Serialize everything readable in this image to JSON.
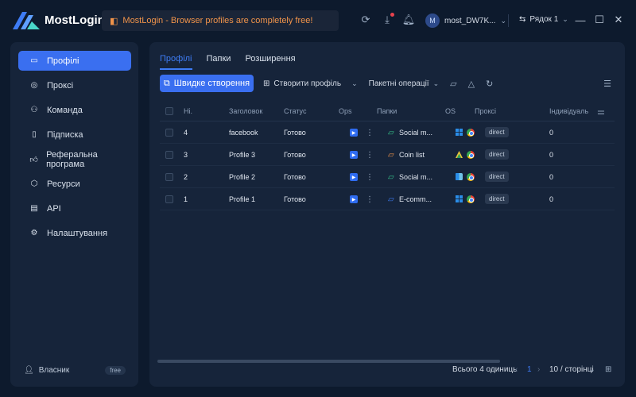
{
  "app": {
    "title": "MostLogin"
  },
  "banner": {
    "text": "MostLogin - Browser profiles are completely free!"
  },
  "header": {
    "user_initial": "M",
    "user_name": "most_DW7K...",
    "language": "Рядок 1"
  },
  "sidebar": {
    "items": [
      {
        "label": "Профілі",
        "icon": "profile-card-icon",
        "active": true
      },
      {
        "label": "Проксі",
        "icon": "location-pin-icon"
      },
      {
        "label": "Команда",
        "icon": "team-icon"
      },
      {
        "label": "Підписка",
        "icon": "subscription-icon"
      },
      {
        "label": "Реферальна програма",
        "icon": "thumbs-up-icon"
      },
      {
        "label": "Ресурси",
        "icon": "cube-icon"
      },
      {
        "label": "API",
        "icon": "api-icon"
      },
      {
        "label": "Налаштування",
        "icon": "gear-icon"
      }
    ],
    "owner_label": "Власник",
    "plan_badge": "free"
  },
  "tabs": [
    {
      "label": "Профілі",
      "active": true
    },
    {
      "label": "Папки"
    },
    {
      "label": "Розширення"
    }
  ],
  "toolbar": {
    "quick_create": "Швидке створення",
    "create_profile": "Створити профіль",
    "batch_ops": "Пакетні операції"
  },
  "table": {
    "columns": [
      "Ні.",
      "Заголовок",
      "Статус",
      "Ops",
      "Папки",
      "OS",
      "Проксі",
      "Індивідуаль"
    ],
    "rows": [
      {
        "no": "4",
        "title": "facebook",
        "status": "Готово",
        "folder": "Social m...",
        "folder_color": "#35c48a",
        "os": "windows",
        "proxy": "direct",
        "individual": "0"
      },
      {
        "no": "3",
        "title": "Profile 3",
        "status": "Готово",
        "folder": "Coin list",
        "folder_color": "#f0934a",
        "os": "android",
        "proxy": "direct",
        "individual": "0"
      },
      {
        "no": "2",
        "title": "Profile 2",
        "status": "Готово",
        "folder": "Social m...",
        "folder_color": "#35c48a",
        "os": "macos",
        "proxy": "direct",
        "individual": "0"
      },
      {
        "no": "1",
        "title": "Profile 1",
        "status": "Готово",
        "folder": "E-comm...",
        "folder_color": "#3e7cf5",
        "os": "windows",
        "proxy": "direct",
        "individual": "0"
      }
    ]
  },
  "pagination": {
    "total_label": "Всього 4 одиниць",
    "current_page": "1",
    "page_size": "10 / сторінці"
  },
  "colors": {
    "accent": "#3a6ff0",
    "banner_text": "#f0934a",
    "background": "#0d1a2d",
    "panel": "#16243a"
  }
}
